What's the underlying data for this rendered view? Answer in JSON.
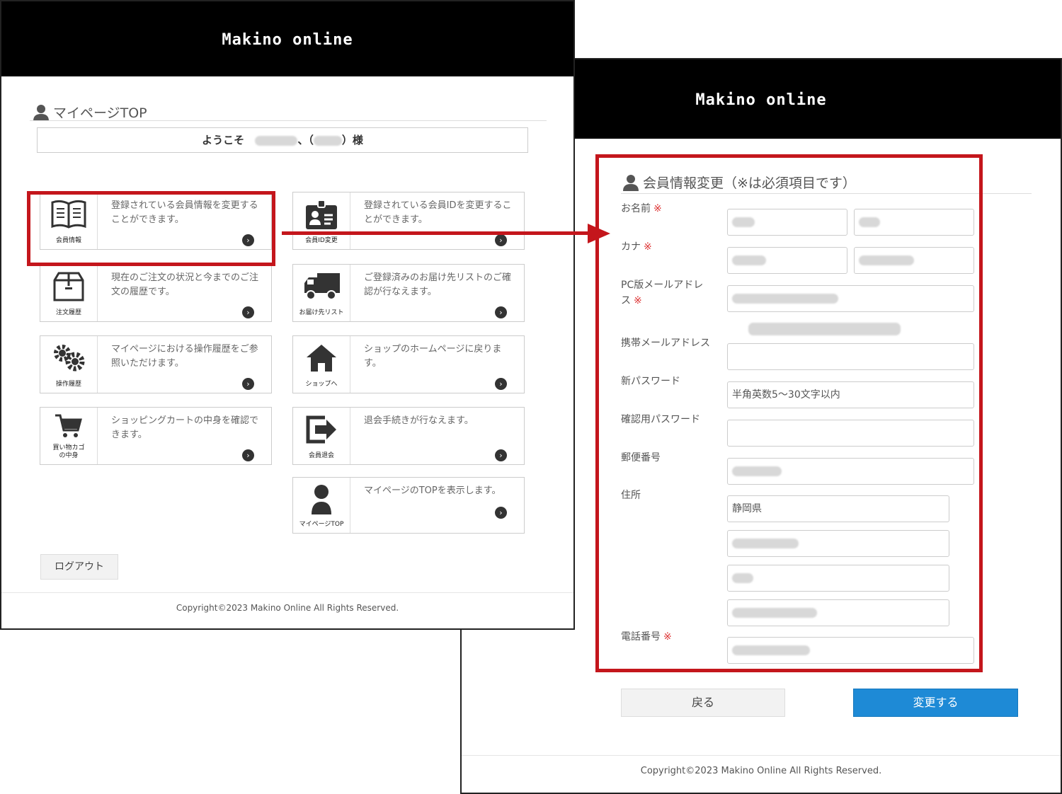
{
  "brand": "Makino online",
  "mypage": {
    "title": "マイページTOP",
    "welcome_prefix": "ようこそ",
    "welcome_sep1": "、（",
    "welcome_sep2": "）様",
    "cards": [
      {
        "label": "会員情報",
        "desc": "登録されている会員情報を変更することができます。",
        "icon": "book-icon"
      },
      {
        "label": "会員ID変更",
        "desc": "登録されている会員IDを変更することができます。",
        "icon": "id-card-icon"
      },
      {
        "label": "注文履歴",
        "desc": "現在のご注文の状況と今までのご注文の履歴です。",
        "icon": "box-icon"
      },
      {
        "label": "お届け先リスト",
        "desc": "ご登録済みのお届け先リストのご確認が行なえます。",
        "icon": "truck-icon"
      },
      {
        "label": "操作履歴",
        "desc": "マイページにおける操作履歴をご参照いただけます。",
        "icon": "gears-icon"
      },
      {
        "label": "ショップへ",
        "desc": "ショップのホームページに戻ります。",
        "icon": "home-icon"
      },
      {
        "label": "買い物カゴ\nの中身",
        "desc": "ショッピングカートの中身を確認できます。",
        "icon": "cart-icon"
      },
      {
        "label": "会員退会",
        "desc": "退会手続きが行なえます。",
        "icon": "exit-icon"
      },
      {
        "label": "マイページTOP",
        "desc": "マイページのTOPを表示します。",
        "icon": "user-icon"
      }
    ],
    "logout": "ログアウト",
    "copyright": "Copyright©2023 Makino Online All Rights Reserved."
  },
  "member_form": {
    "title": "会員情報変更（※は必須項目です）",
    "required_mark": "※",
    "labels": {
      "name": "お名前",
      "kana": "カナ",
      "pc_email": "PC版メールアドレス",
      "mobile_email": "携帯メールアドレス",
      "new_password": "新パスワード",
      "confirm_password": "確認用パスワード",
      "postal": "郵便番号",
      "address": "住所",
      "phone": "電話番号"
    },
    "new_password_placeholder": "半角英数5～30文字以内",
    "prefecture": "静岡県",
    "back": "戻る",
    "submit": "変更する",
    "copyright": "Copyright©2023 Makino Online All Rights Reserved."
  },
  "colors": {
    "highlight": "#c4161c",
    "primary": "#1e8ad6",
    "header": "#000000"
  }
}
